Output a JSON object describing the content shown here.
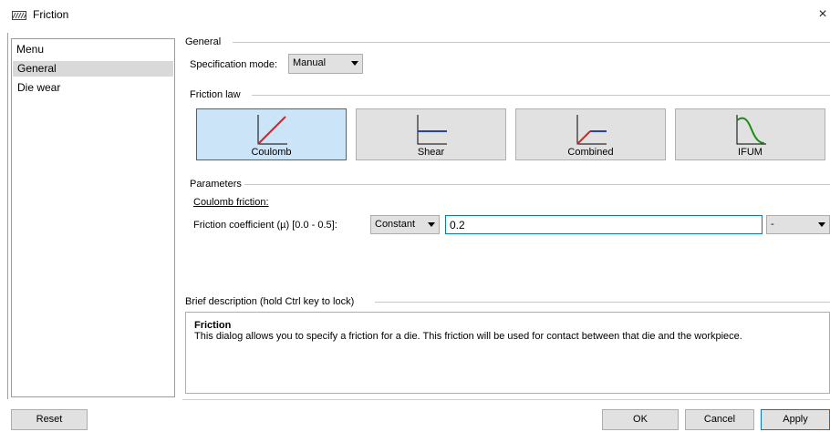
{
  "window": {
    "title": "Friction",
    "close_glyph": "×"
  },
  "menu": {
    "header": "Menu",
    "items": [
      {
        "label": "General",
        "selected": true
      },
      {
        "label": "Die wear",
        "selected": false
      }
    ]
  },
  "general": {
    "section_label": "General",
    "spec_mode_label": "Specification mode:",
    "spec_mode_value": "Manual"
  },
  "friction_law": {
    "section_label": "Friction law",
    "options": [
      {
        "label": "Coulomb",
        "icon": "coulomb-icon",
        "active": true
      },
      {
        "label": "Shear",
        "icon": "shear-icon",
        "active": false
      },
      {
        "label": "Combined",
        "icon": "combined-icon",
        "active": false
      },
      {
        "label": "IFUM",
        "icon": "ifum-icon",
        "active": false
      }
    ]
  },
  "parameters": {
    "section_label": "Parameters",
    "subheading": "Coulomb friction:",
    "coefficient_label": "Friction coefficient (µ) [0.0 - 0.5]:",
    "type_value": "Constant",
    "coefficient_value": "0.2",
    "unit_value": "-"
  },
  "description": {
    "section_label": "Brief description (hold Ctrl key to lock)",
    "title": "Friction",
    "text": "This dialog allows you to specify a friction for a die. This friction will be used for contact between that die and the workpiece."
  },
  "buttons": {
    "reset": "Reset",
    "ok": "OK",
    "cancel": "Cancel",
    "apply": "Apply"
  },
  "colors": {
    "accent": "#0078d7",
    "active_bg": "#cce4f7",
    "curve_red": "#e02020",
    "curve_blue": "#1f3fd4",
    "curve_green": "#1a8a1a"
  }
}
